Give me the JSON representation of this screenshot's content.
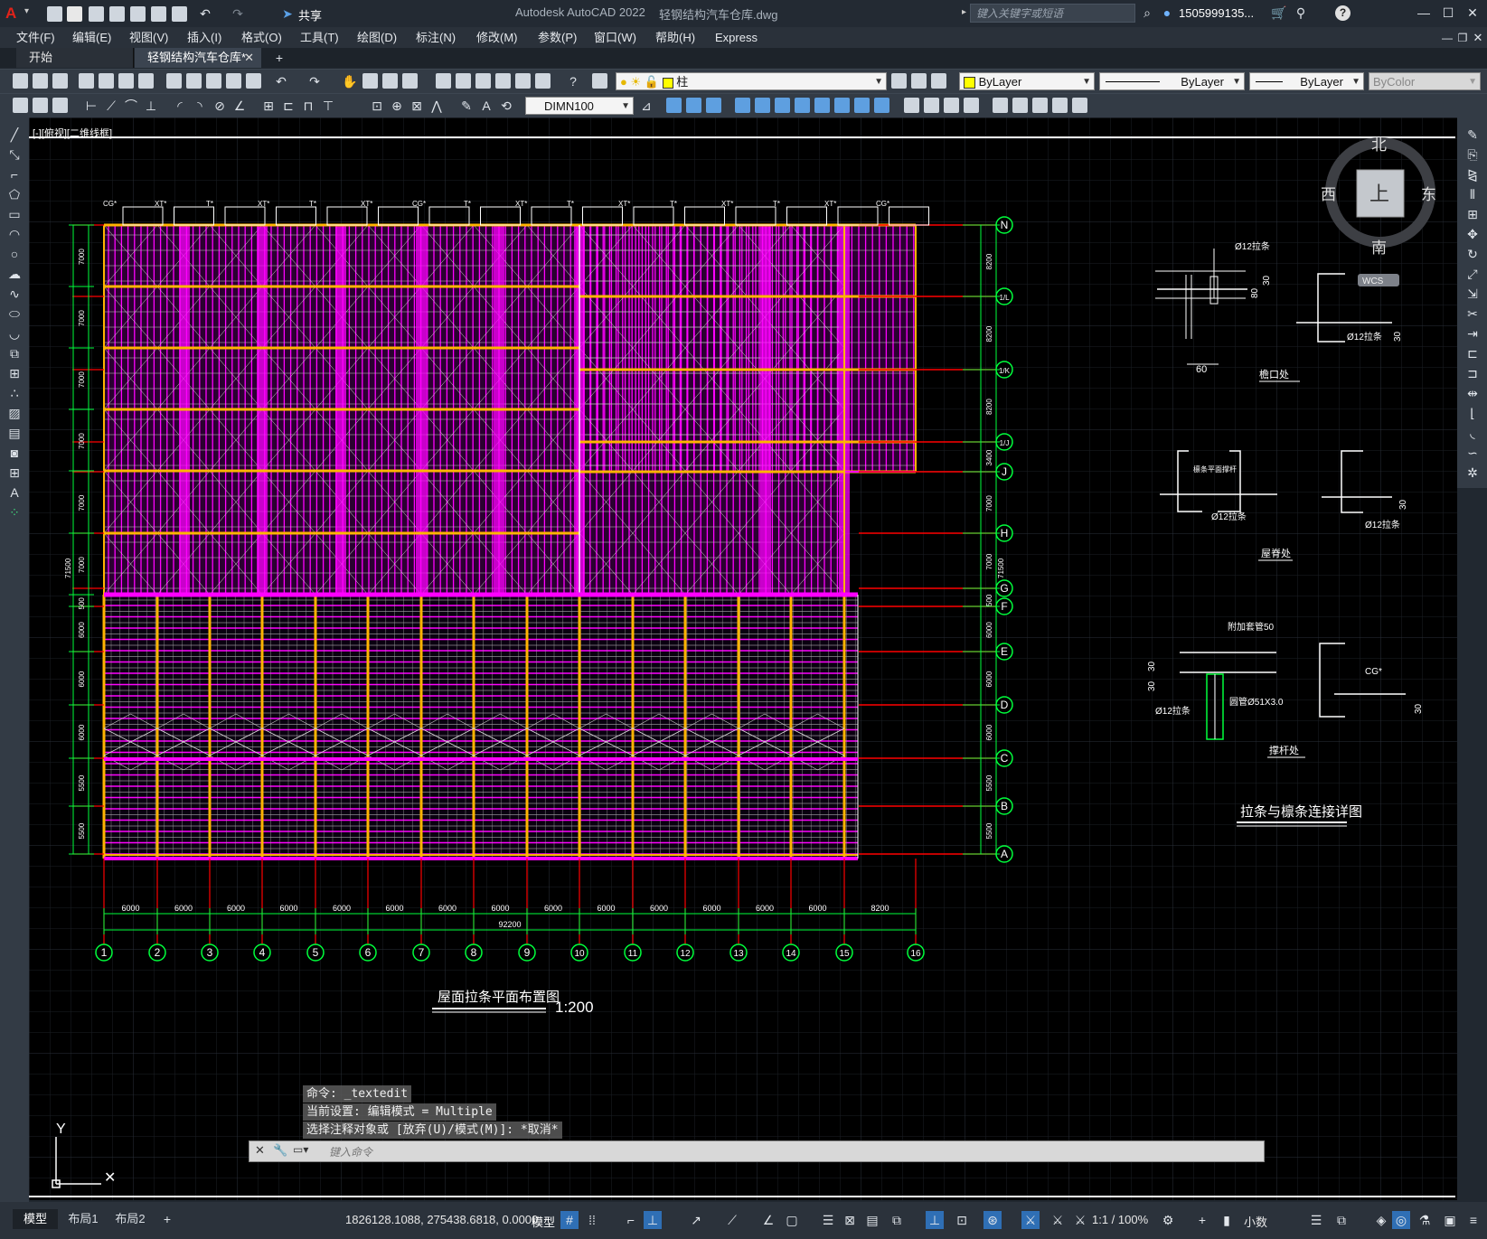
{
  "app": {
    "title": "Autodesk AutoCAD 2022",
    "filename": "轻钢结构汽车仓库.dwg",
    "share_label": "共享",
    "search_placeholder": "键入关键字或短语",
    "user": "1505999135...",
    "help": "?"
  },
  "menu": [
    "文件(F)",
    "编辑(E)",
    "视图(V)",
    "插入(I)",
    "格式(O)",
    "工具(T)",
    "绘图(D)",
    "标注(N)",
    "修改(M)",
    "参数(P)",
    "窗口(W)",
    "帮助(H)",
    "Express"
  ],
  "doc_tabs": [
    {
      "label": "开始",
      "active": false
    },
    {
      "label": "轻钢结构汽车仓库*",
      "active": true
    }
  ],
  "toolbar": {
    "layer": "柱",
    "color": "ByLayer",
    "linetype": "ByLayer",
    "lineweight": "ByLayer",
    "plotstyle": "ByColor",
    "dimstyle": "DIMN100"
  },
  "viewcube": {
    "north": "北",
    "south": "南",
    "east": "东",
    "west": "西",
    "face": "上",
    "wcs": "WCS"
  },
  "drawing": {
    "main_title": "屋面拉条平面布置图",
    "main_scale": "1:200",
    "detail_title": "拉条与檩条连接详图",
    "detail_labels": {
      "eave": "檐口处",
      "ridge": "屋脊处",
      "strut": "撑杆处",
      "rod12": "Ø12拉条",
      "d60": "60",
      "d30": "30",
      "d80": "80",
      "stiff": "檩条平面撑杆",
      "pipe": "圆管Ø51X3.0",
      "sleeve": "附加套管50",
      "cg": "CG*"
    },
    "row_axes": [
      "N",
      "1/L",
      "1/K",
      "1/J",
      "J",
      "H",
      "G",
      "F",
      "E",
      "D",
      "C",
      "B",
      "A"
    ],
    "col_axes": [
      "1",
      "2",
      "3",
      "4",
      "5",
      "6",
      "7",
      "8",
      "9",
      "10",
      "11",
      "12",
      "13",
      "14",
      "15",
      "16"
    ],
    "bay_dims": [
      "6000",
      "6000",
      "6000",
      "6000",
      "6000",
      "6000",
      "6000",
      "6000",
      "6000",
      "6000",
      "6000",
      "6000",
      "6000",
      "6000",
      "8200"
    ],
    "total_dim": "92200",
    "left_dims": [
      "7000",
      "7000",
      "7000",
      "7000",
      "7000",
      "7000",
      "500",
      "6000",
      "6000",
      "6000",
      "5500",
      "5500"
    ],
    "left_total": "71500",
    "right_dims": [
      "8200",
      "8200",
      "8200",
      "3400",
      "7000",
      "7000",
      "500",
      "6000",
      "6000",
      "6000",
      "5500",
      "5500"
    ],
    "right_total": "71500",
    "top_labels": [
      "CG*",
      "XT*",
      "T*",
      "XT*",
      "T*",
      "XT*",
      "CG*",
      "T*",
      "XT*",
      "T*",
      "XT*",
      "T*",
      "XT*",
      "T*",
      "XT*",
      "CG*"
    ]
  },
  "command": {
    "history": [
      "命令: _textedit",
      "当前设置: 编辑模式 = Multiple",
      "选择注释对象或 [放弃(U)/模式(M)]: *取消*"
    ],
    "placeholder": "键入命令"
  },
  "layout_tabs": [
    "模型",
    "布局1",
    "布局2"
  ],
  "status": {
    "coords": "1826128.1088, 275438.6818, 0.0000",
    "model": "模型",
    "scale": "1:1 / 100%",
    "units": "小数"
  },
  "colors": {
    "magenta": "#ff00ff",
    "yellow": "#ffb400",
    "green": "#00ff3c",
    "red": "#ff0000",
    "white": "#ffffff",
    "canvas": "#000000"
  }
}
